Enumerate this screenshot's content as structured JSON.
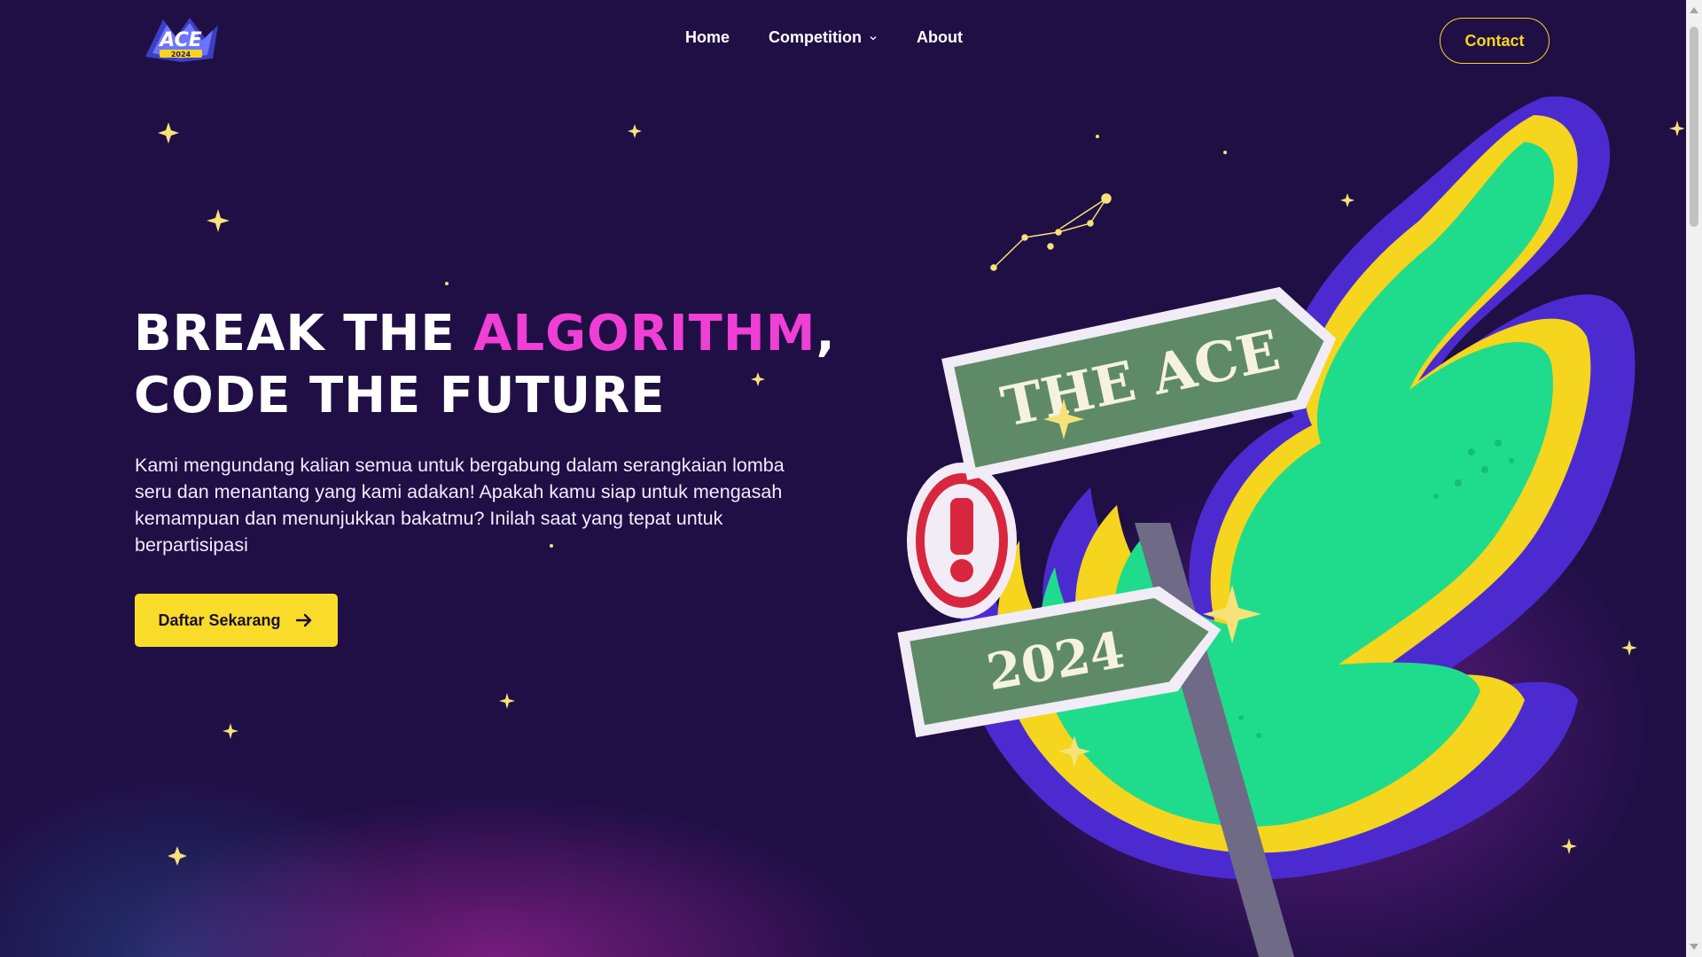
{
  "nav": {
    "logo_text": "ACE 2024",
    "menu": [
      {
        "label": "Home"
      },
      {
        "label": "Competition",
        "has_dropdown": true
      },
      {
        "label": "About"
      }
    ],
    "contact_label": "Contact"
  },
  "hero": {
    "headline_part1": "Break the ",
    "headline_accent": "Algorithm",
    "headline_part2": ",",
    "headline_line2": "Code the Future",
    "description": "Kami mengundang kalian semua untuk bergabung dalam serangkaian lomba seru dan menantang yang kami adakan! Apakah kamu siap untuk mengasah kemampuan dan menunjukkan bakatmu? Inilah saat yang tepat untuk berpartisipasi",
    "cta_label": "Daftar Sekarang"
  },
  "illustration": {
    "sign_top": "THE ACE",
    "sign_bottom": "2024"
  },
  "colors": {
    "background": "#1f0f45",
    "accent_pink": "#ef3fd4",
    "accent_yellow": "#f9dc2a",
    "accent_green": "#1fdc8c"
  },
  "icons": {
    "cta_icon": "arrow-right-icon",
    "dropdown_icon": "chevron-down-icon",
    "sign_icon": "exclamation-icon"
  }
}
